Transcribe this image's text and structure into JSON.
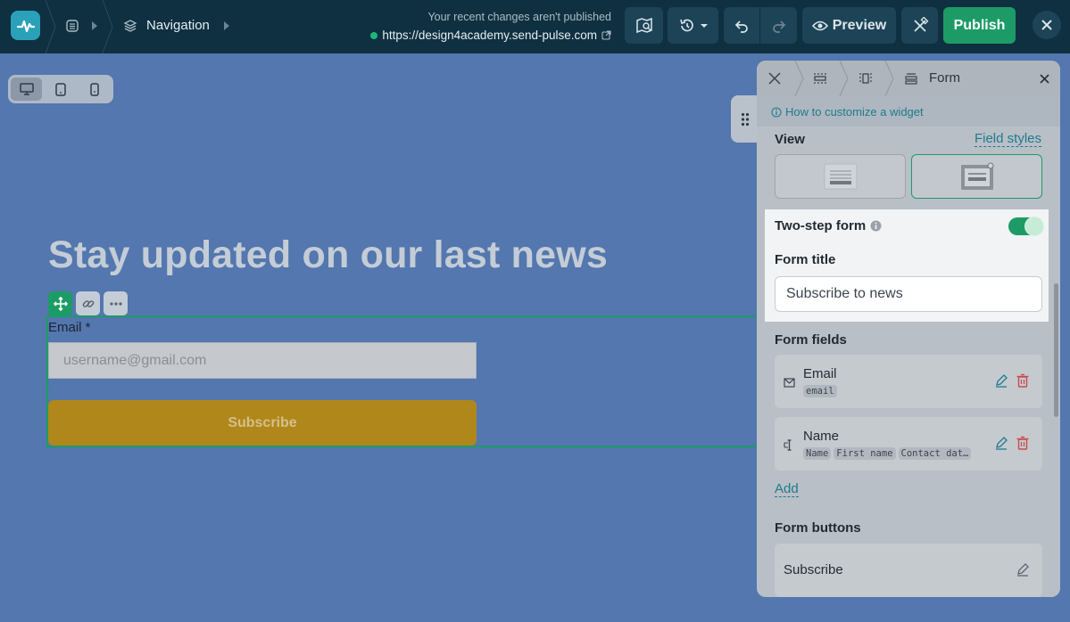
{
  "header": {
    "breadcrumb_label": "Navigation",
    "unpublished_notice": "Your recent changes aren't published",
    "site_url": "https://design4academy.send-pulse.com",
    "preview_label": "Preview",
    "publish_label": "Publish"
  },
  "canvas": {
    "headline": "Stay updated on our last news",
    "email_label": "Email *",
    "email_placeholder": "username@gmail.com",
    "subscribe_label": "Subscribe"
  },
  "panel": {
    "title": "Form",
    "howto_link": "How to customize a widget",
    "view_label": "View",
    "field_styles_link": "Field styles",
    "two_step_label": "Two-step form",
    "two_step_enabled": true,
    "form_title_label": "Form title",
    "form_title_value": "Subscribe to news",
    "form_fields_label": "Form fields",
    "fields": [
      {
        "name": "Email",
        "icon": "envelope-icon",
        "tags": [
          "email"
        ]
      },
      {
        "name": "Name",
        "icon": "text-cursor-icon",
        "tags": [
          "Name",
          "First name",
          "Contact dat…"
        ]
      }
    ],
    "add_label": "Add",
    "form_buttons_label": "Form buttons",
    "buttons": [
      {
        "name": "Subscribe"
      }
    ]
  },
  "colors": {
    "topbar": "#0f3041",
    "accent_green": "#1d9b66",
    "canvas_bg": "#5377ae",
    "link": "#1e7b8e"
  }
}
